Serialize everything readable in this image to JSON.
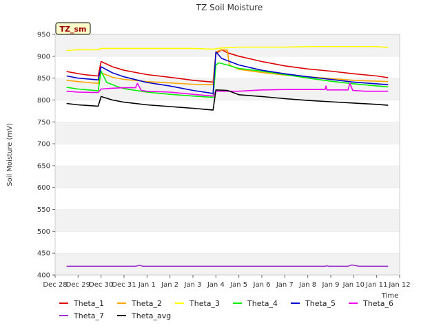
{
  "chart_data": {
    "type": "line",
    "title": "TZ Soil Moisture",
    "xlabel": "Time",
    "ylabel": "Soil Moisture (mV)",
    "badge": "TZ_sm",
    "xlim": [
      "2022-12-28",
      "2023-01-12"
    ],
    "ylim": [
      400,
      950
    ],
    "x_ticks": [
      {
        "date": "2022-12-28",
        "label": "Dec 28"
      },
      {
        "date": "2022-12-29",
        "label": "Dec 29"
      },
      {
        "date": "2022-12-30",
        "label": "Dec 30"
      },
      {
        "date": "2022-12-31",
        "label": "Dec 31"
      },
      {
        "date": "2023-01-01",
        "label": "Jan 1"
      },
      {
        "date": "2023-01-02",
        "label": "Jan 2"
      },
      {
        "date": "2023-01-03",
        "label": "Jan 3"
      },
      {
        "date": "2023-01-04",
        "label": "Jan 4"
      },
      {
        "date": "2023-01-05",
        "label": "Jan 5"
      },
      {
        "date": "2023-01-06",
        "label": "Jan 6"
      },
      {
        "date": "2023-01-07",
        "label": "Jan 7"
      },
      {
        "date": "2023-01-08",
        "label": "Jan 8"
      },
      {
        "date": "2023-01-09",
        "label": "Jan 9"
      },
      {
        "date": "2023-01-10",
        "label": "Jan 10"
      },
      {
        "date": "2023-01-11",
        "label": "Jan 11"
      },
      {
        "date": "2023-01-12",
        "label": "Jan 12"
      }
    ],
    "y_ticks": [
      400,
      450,
      500,
      550,
      600,
      650,
      700,
      750,
      800,
      850,
      900,
      950
    ],
    "grid": "horizontal alternating bands",
    "legend_position": "bottom",
    "series": [
      {
        "name": "Theta_1",
        "color": "#dd0000",
        "points": [
          [
            "2022-12-28 12:00",
            865
          ],
          [
            "2022-12-29 06:00",
            858
          ],
          [
            "2022-12-29 21:00",
            855
          ],
          [
            "2022-12-30 00:00",
            888
          ],
          [
            "2022-12-30 12:00",
            876
          ],
          [
            "2022-12-31 00:00",
            868
          ],
          [
            "2023-01-01 00:00",
            858
          ],
          [
            "2023-01-02 00:00",
            852
          ],
          [
            "2023-01-03 00:00",
            845
          ],
          [
            "2023-01-03 21:00",
            841
          ],
          [
            "2023-01-04 00:00",
            906
          ],
          [
            "2023-01-04 06:00",
            915
          ],
          [
            "2023-01-04 12:00",
            908
          ],
          [
            "2023-01-05 00:00",
            900
          ],
          [
            "2023-01-06 00:00",
            888
          ],
          [
            "2023-01-07 00:00",
            878
          ],
          [
            "2023-01-08 00:00",
            871
          ],
          [
            "2023-01-09 00:00",
            866
          ],
          [
            "2023-01-10 00:00",
            860
          ],
          [
            "2023-01-11 00:00",
            855
          ],
          [
            "2023-01-11 12:00",
            851
          ]
        ]
      },
      {
        "name": "Theta_2",
        "color": "#ffa500",
        "points": [
          [
            "2022-12-28 12:00",
            845
          ],
          [
            "2022-12-29 00:00",
            842
          ],
          [
            "2022-12-29 21:00",
            838
          ],
          [
            "2022-12-30 00:00",
            862
          ],
          [
            "2022-12-30 12:00",
            852
          ],
          [
            "2022-12-31 00:00",
            847
          ],
          [
            "2023-01-01 00:00",
            842
          ],
          [
            "2023-01-02 00:00",
            839
          ],
          [
            "2023-01-03 00:00",
            836
          ],
          [
            "2023-01-03 21:00",
            835
          ],
          [
            "2023-01-04 00:00",
            910
          ],
          [
            "2023-01-04 06:00",
            915
          ],
          [
            "2023-01-04 12:00",
            914
          ],
          [
            "2023-01-04 14:00",
            880
          ],
          [
            "2023-01-05 00:00",
            870
          ],
          [
            "2023-01-06 00:00",
            863
          ],
          [
            "2023-01-07 00:00",
            857
          ],
          [
            "2023-01-08 00:00",
            853
          ],
          [
            "2023-01-09 00:00",
            849
          ],
          [
            "2023-01-10 00:00",
            845
          ],
          [
            "2023-01-11 12:00",
            842
          ]
        ]
      },
      {
        "name": "Theta_3",
        "color": "#ffff00",
        "points": [
          [
            "2022-12-28 12:00",
            913
          ],
          [
            "2022-12-29 00:00",
            915
          ],
          [
            "2022-12-29 21:00",
            915
          ],
          [
            "2022-12-30 00:00",
            918
          ],
          [
            "2023-01-01 00:00",
            918
          ],
          [
            "2023-01-03 00:00",
            918
          ],
          [
            "2023-01-03 21:00",
            916
          ],
          [
            "2023-01-04 06:00",
            919
          ],
          [
            "2023-01-05 00:00",
            921
          ],
          [
            "2023-01-07 00:00",
            921
          ],
          [
            "2023-01-08 00:00",
            922
          ],
          [
            "2023-01-10 00:00",
            922
          ],
          [
            "2023-01-11 00:00",
            922
          ],
          [
            "2023-01-11 12:00",
            920
          ]
        ]
      },
      {
        "name": "Theta_4",
        "color": "#00ee00",
        "points": [
          [
            "2022-12-28 12:00",
            829
          ],
          [
            "2022-12-29 00:00",
            825
          ],
          [
            "2022-12-29 21:00",
            821
          ],
          [
            "2022-12-30 00:00",
            866
          ],
          [
            "2022-12-30 06:00",
            840
          ],
          [
            "2022-12-30 18:00",
            830
          ],
          [
            "2022-12-31 00:00",
            826
          ],
          [
            "2023-01-01 00:00",
            818
          ],
          [
            "2023-01-02 00:00",
            813
          ],
          [
            "2023-01-03 00:00",
            809
          ],
          [
            "2023-01-03 21:00",
            806
          ],
          [
            "2023-01-04 00:00",
            880
          ],
          [
            "2023-01-04 03:00",
            885
          ],
          [
            "2023-01-04 12:00",
            880
          ],
          [
            "2023-01-05 00:00",
            872
          ],
          [
            "2023-01-06 00:00",
            866
          ],
          [
            "2023-01-07 00:00",
            858
          ],
          [
            "2023-01-08 00:00",
            850
          ],
          [
            "2023-01-09 00:00",
            843
          ],
          [
            "2023-01-10 00:00",
            837
          ],
          [
            "2023-01-11 12:00",
            830
          ]
        ]
      },
      {
        "name": "Theta_5",
        "color": "#0000cc",
        "points": [
          [
            "2022-12-28 12:00",
            855
          ],
          [
            "2022-12-29 00:00",
            850
          ],
          [
            "2022-12-29 21:00",
            846
          ],
          [
            "2022-12-30 00:00",
            876
          ],
          [
            "2022-12-30 12:00",
            862
          ],
          [
            "2022-12-31 00:00",
            853
          ],
          [
            "2023-01-01 00:00",
            840
          ],
          [
            "2023-01-02 00:00",
            832
          ],
          [
            "2023-01-03 00:00",
            822
          ],
          [
            "2023-01-03 21:00",
            815
          ],
          [
            "2023-01-04 00:00",
            910
          ],
          [
            "2023-01-04 06:00",
            895
          ],
          [
            "2023-01-05 00:00",
            880
          ],
          [
            "2023-01-06 00:00",
            868
          ],
          [
            "2023-01-07 00:00",
            860
          ],
          [
            "2023-01-08 00:00",
            853
          ],
          [
            "2023-01-09 00:00",
            847
          ],
          [
            "2023-01-10 00:00",
            841
          ],
          [
            "2023-01-11 12:00",
            835
          ]
        ]
      },
      {
        "name": "Theta_6",
        "color": "#ee00ee",
        "points": [
          [
            "2022-12-28 12:00",
            820
          ],
          [
            "2022-12-29 00:00",
            818
          ],
          [
            "2022-12-29 21:00",
            817
          ],
          [
            "2022-12-30 00:00",
            825
          ],
          [
            "2022-12-30 12:00",
            827
          ],
          [
            "2022-12-31 00:00",
            828
          ],
          [
            "2022-12-31 12:00",
            828
          ],
          [
            "2022-12-31 14:00",
            838
          ],
          [
            "2022-12-31 18:00",
            822
          ],
          [
            "2023-01-01 00:00",
            820
          ],
          [
            "2023-01-02 00:00",
            818
          ],
          [
            "2023-01-03 00:00",
            813
          ],
          [
            "2023-01-03 21:00",
            809
          ],
          [
            "2023-01-04 00:00",
            820
          ],
          [
            "2023-01-05 00:00",
            820
          ],
          [
            "2023-01-06 00:00",
            823
          ],
          [
            "2023-01-07 00:00",
            824
          ],
          [
            "2023-01-08 00:00",
            824
          ],
          [
            "2023-01-08 18:00",
            824
          ],
          [
            "2023-01-08 19:00",
            832
          ],
          [
            "2023-01-08 20:00",
            823
          ],
          [
            "2023-01-09 18:00",
            823
          ],
          [
            "2023-01-09 20:00",
            838
          ],
          [
            "2023-01-09 23:00",
            822
          ],
          [
            "2023-01-10 12:00",
            820
          ],
          [
            "2023-01-11 12:00",
            820
          ]
        ]
      },
      {
        "name": "Theta_7",
        "color": "#9933cc",
        "points": [
          [
            "2022-12-28 12:00",
            420
          ],
          [
            "2022-12-31 12:00",
            420
          ],
          [
            "2022-12-31 16:00",
            422
          ],
          [
            "2022-12-31 20:00",
            420
          ],
          [
            "2023-01-08 18:00",
            420
          ],
          [
            "2023-01-08 20:00",
            421
          ],
          [
            "2023-01-08 22:00",
            420
          ],
          [
            "2023-01-09 18:00",
            420
          ],
          [
            "2023-01-09 22:00",
            423
          ],
          [
            "2023-01-10 06:00",
            420
          ],
          [
            "2023-01-11 12:00",
            420
          ]
        ]
      },
      {
        "name": "Theta_avg",
        "color": "#000000",
        "points": [
          [
            "2022-12-28 12:00",
            792
          ],
          [
            "2022-12-29 00:00",
            789
          ],
          [
            "2022-12-29 21:00",
            786
          ],
          [
            "2022-12-30 00:00",
            808
          ],
          [
            "2022-12-30 12:00",
            800
          ],
          [
            "2022-12-31 00:00",
            795
          ],
          [
            "2023-01-01 00:00",
            789
          ],
          [
            "2023-01-02 00:00",
            785
          ],
          [
            "2023-01-03 00:00",
            781
          ],
          [
            "2023-01-03 21:00",
            777
          ],
          [
            "2023-01-04 00:00",
            823
          ],
          [
            "2023-01-04 12:00",
            822
          ],
          [
            "2023-01-05 00:00",
            812
          ],
          [
            "2023-01-06 00:00",
            808
          ],
          [
            "2023-01-07 00:00",
            803
          ],
          [
            "2023-01-08 00:00",
            799
          ],
          [
            "2023-01-09 00:00",
            796
          ],
          [
            "2023-01-10 00:00",
            793
          ],
          [
            "2023-01-11 00:00",
            790
          ],
          [
            "2023-01-11 12:00",
            788
          ]
        ]
      }
    ]
  }
}
